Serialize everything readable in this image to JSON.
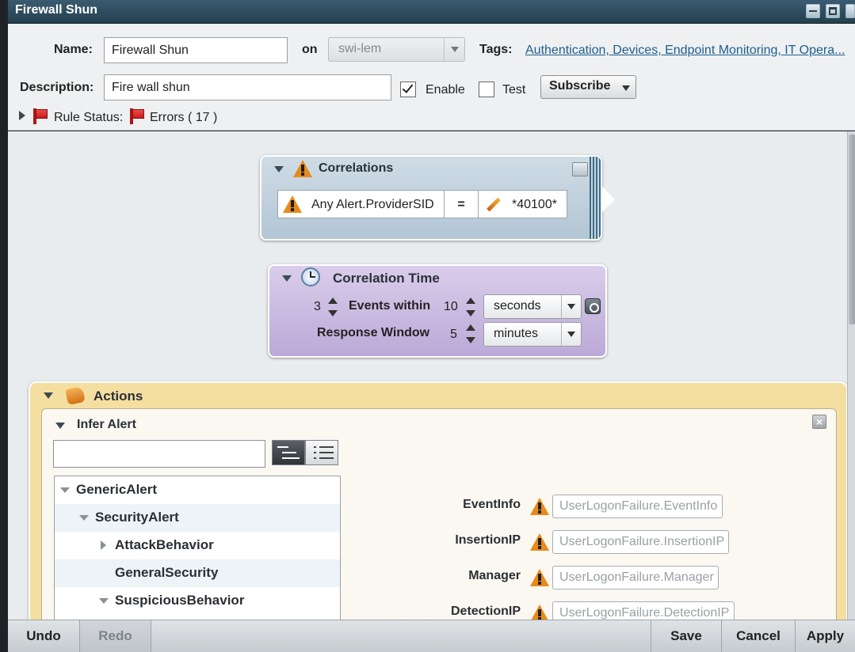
{
  "window": {
    "title": "Firewall Shun"
  },
  "header": {
    "name_label": "Name:",
    "name_value": "Firewall Shun",
    "on_label": "on",
    "on_value": "swi-lem",
    "tags_label": "Tags:",
    "tags_value": "Authentication, Devices, Endpoint Monitoring, IT Opera...",
    "description_label": "Description:",
    "description_value": "Fire wall shun",
    "enable_label": "Enable",
    "enable_checked": true,
    "test_label": "Test",
    "test_checked": false,
    "subscribe_label": "Subscribe",
    "rule_status_label": "Rule Status:",
    "errors_label": "Errors ( 17 )"
  },
  "correlations": {
    "title": "Correlations",
    "field": "Any Alert.ProviderSID",
    "operator": "=",
    "value": "*40100*"
  },
  "correlation_time": {
    "title": "Correlation Time",
    "events_count": "3",
    "events_within_label": "Events within",
    "within_value": "10",
    "within_unit": "seconds",
    "response_window_label": "Response Window",
    "response_value": "5",
    "response_unit": "minutes"
  },
  "actions": {
    "title": "Actions",
    "infer_alert": {
      "title": "Infer Alert",
      "search_value": "",
      "tree": [
        {
          "label": "GenericAlert",
          "level": 0,
          "state": "expanded"
        },
        {
          "label": "SecurityAlert",
          "level": 1,
          "state": "expanded"
        },
        {
          "label": "AttackBehavior",
          "level": 2,
          "state": "collapsed"
        },
        {
          "label": "GeneralSecurity",
          "level": 2,
          "state": "leaf"
        },
        {
          "label": "SuspiciousBehavior",
          "level": 2,
          "state": "expanded"
        }
      ],
      "fields": [
        {
          "label": "EventInfo",
          "value": "UserLogonFailure.EventInfo"
        },
        {
          "label": "InsertionIP",
          "value": "UserLogonFailure.InsertionIP"
        },
        {
          "label": "Manager",
          "value": "UserLogonFailure.Manager"
        },
        {
          "label": "DetectionIP",
          "value": "UserLogonFailure.DetectionIP"
        }
      ]
    }
  },
  "bottom_bar": {
    "undo": "Undo",
    "redo": "Redo",
    "save": "Save",
    "cancel": "Cancel",
    "apply": "Apply"
  },
  "colors": {
    "title_bar": "#2f4d5f",
    "correlations_bg": "#c3d3df",
    "correlation_time_bg": "#cbbde2",
    "actions_bg": "#f5dfa0",
    "warning": "#e88a1a",
    "link": "#1e5f8f"
  }
}
